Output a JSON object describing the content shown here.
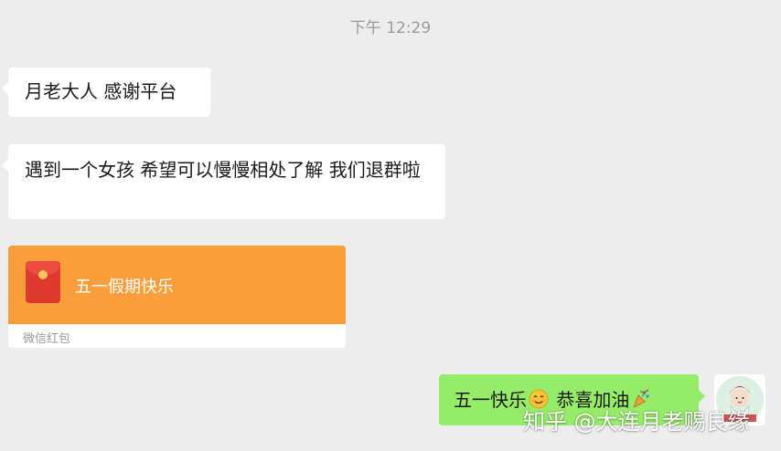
{
  "timestamp": "下午 12:29",
  "messages": {
    "m1": "月老大人 感谢平台",
    "m2": "遇到一个女孩 希望可以慢慢相处了解 我们退群啦",
    "red_packet": {
      "greeting": "五一假期快乐",
      "source": "微信红包"
    },
    "m3": {
      "text_a": "五一快乐",
      "emoji_a": "smile-emoji",
      "text_b": " 恭喜加油",
      "emoji_b": "party-popper-emoji"
    }
  },
  "watermark": "知乎 @大连月老赐良缘",
  "colors": {
    "background": "#ededed",
    "bubble_incoming": "#ffffff",
    "bubble_outgoing": "#95ec69",
    "red_packet": "#fa9d3b",
    "red_envelope": "#e03a2f"
  }
}
